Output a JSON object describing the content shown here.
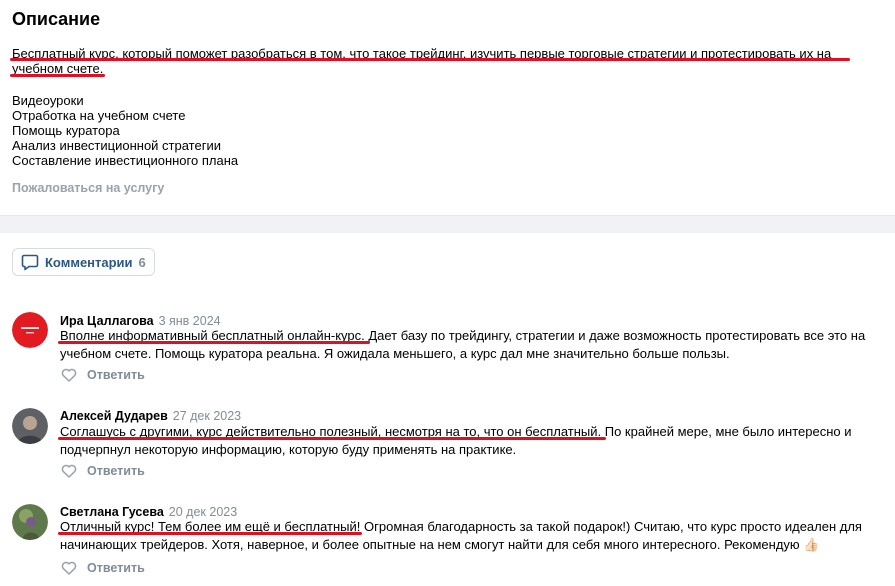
{
  "description": {
    "title": "Описание",
    "text": "Бесплатный курс, который поможет разобраться в том, что такое трейдинг, изучить первые торговые стратегии и протестировать их на учебном счете.",
    "features": [
      "Видеоуроки",
      "Отработка на учебном счете",
      "Помощь куратора",
      "Анализ инвестиционной стратегии",
      "Составление инвестиционного плана"
    ],
    "report_label": "Пожаловаться на услугу"
  },
  "comments_tab": {
    "label": "Комментарии",
    "count": "6"
  },
  "comments": [
    {
      "author": "Ира Цаллагова",
      "date": "3 янв 2024",
      "highlight": "Вполне информативный бесплатный онлайн-курс",
      "rest": ". Дает базу по трейдингу, стратегии и даже возможность протестировать все это на учебном счете. Помощь куратора реальна. Я ожидала меньшего, а курс дал мне значительно больше пользы.",
      "reply_label": "Ответить"
    },
    {
      "author": "Алексей Дударев",
      "date": "27 дек 2023",
      "highlight": "Соглашусь с другими, курс действительно полезный, несмотря на то, что он бесплатный",
      "rest": ". По крайней мере, мне было интересно и подчерпнул некоторую информацию, которую буду применять на практике.",
      "reply_label": "Ответить"
    },
    {
      "author": "Светлана Гусева",
      "date": "20 дек 2023",
      "highlight": "Отличный курс! Тем более им ещё и бесплатный!",
      "rest": " Огромная благодарность за такой подарок!) Считаю, что курс просто идеален для начинающих трейдеров. Хотя, наверное, и более опытные на нем смогут найти для себя много интересного. Рекомендую",
      "emoji": "👍🏻",
      "reply_label": "Ответить"
    }
  ],
  "colors": {
    "link": "#2a5885",
    "muted": "#818c99",
    "annotation_red": "#e01020"
  }
}
